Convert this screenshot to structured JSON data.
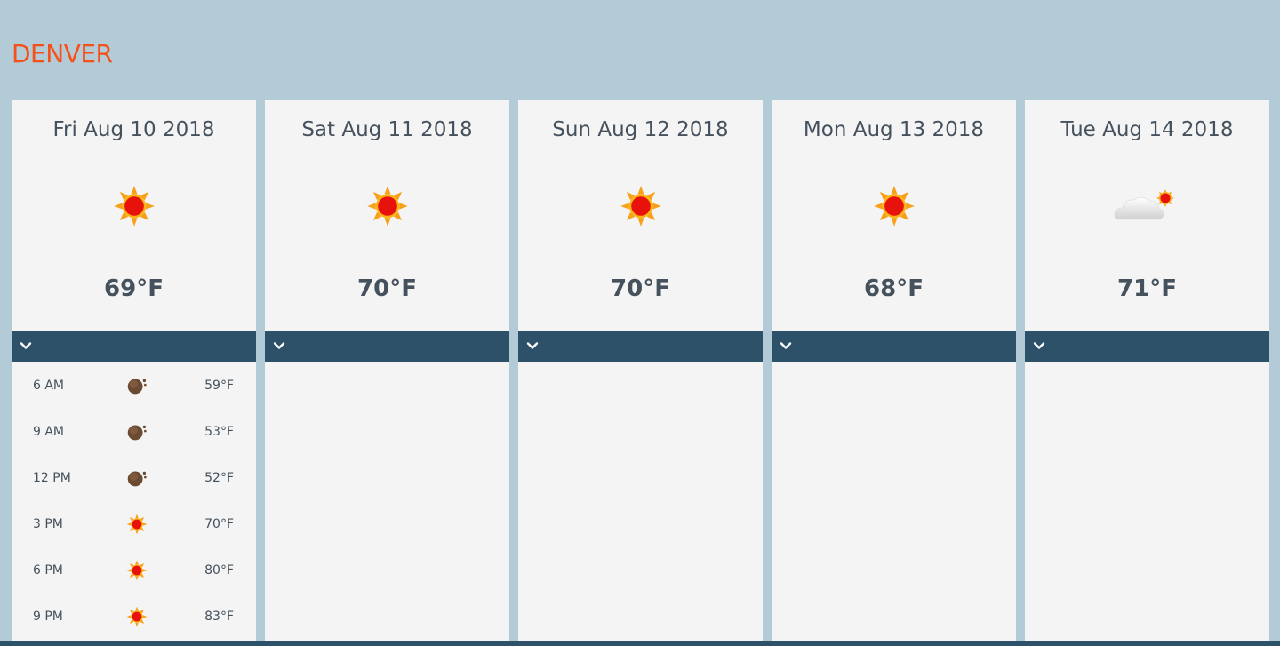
{
  "city": "DENVER",
  "days": [
    {
      "date": "Fri Aug 10 2018",
      "icon": "sun-icon",
      "temp": "69°F"
    },
    {
      "date": "Sat Aug 11 2018",
      "icon": "sun-icon",
      "temp": "70°F"
    },
    {
      "date": "Sun Aug 12 2018",
      "icon": "sun-icon",
      "temp": "70°F"
    },
    {
      "date": "Mon Aug 13 2018",
      "icon": "sun-icon",
      "temp": "68°F"
    },
    {
      "date": "Tue Aug 14 2018",
      "icon": "partly-cloudy-icon",
      "temp": "71°F"
    }
  ],
  "hourly": [
    {
      "time": "6 AM",
      "icon": "moon-icon",
      "temp": "59°F"
    },
    {
      "time": "9 AM",
      "icon": "moon-icon",
      "temp": "53°F"
    },
    {
      "time": "12 PM",
      "icon": "moon-icon",
      "temp": "52°F"
    },
    {
      "time": "3 PM",
      "icon": "sun-icon",
      "temp": "70°F"
    },
    {
      "time": "6 PM",
      "icon": "sun-icon",
      "temp": "80°F"
    },
    {
      "time": "9 PM",
      "icon": "sun-icon",
      "temp": "83°F"
    }
  ],
  "colors": {
    "accent": "#f5501a",
    "bar": "#2d5168",
    "background": "#b3cbd7",
    "card": "#f4f4f4"
  }
}
